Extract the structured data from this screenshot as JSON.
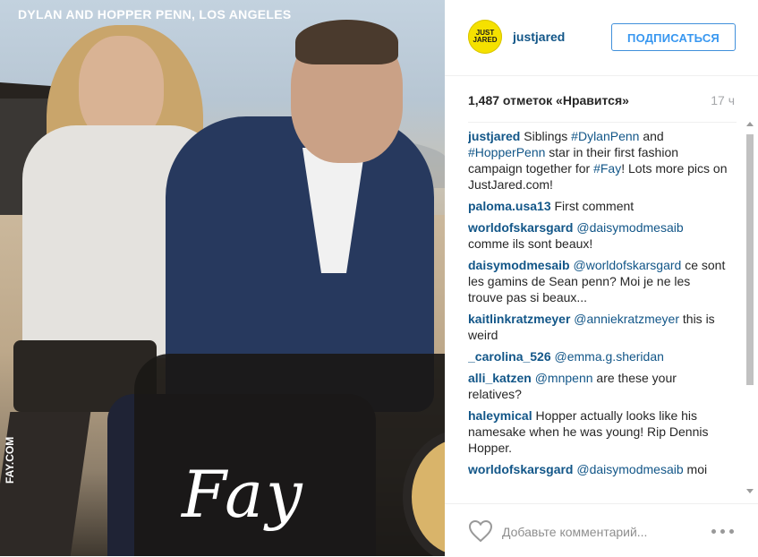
{
  "photo": {
    "caption": "DYLAN AND HOPPER PENN, LOS ANGELES",
    "brand": "Fay",
    "url_text": "FAY.COM"
  },
  "header": {
    "avatar_text": "JUST JARED",
    "username": "justjared",
    "follow_label": "ПОДПИСАТЬСЯ"
  },
  "stats": {
    "likes": "1,487 отметок «Нравится»",
    "time": "17 ч"
  },
  "comments": [
    {
      "user": "justjared",
      "parts": [
        {
          "t": "text",
          "v": " Siblings "
        },
        {
          "t": "tag",
          "v": "#DylanPenn"
        },
        {
          "t": "text",
          "v": " and "
        },
        {
          "t": "tag",
          "v": "#HopperPenn"
        },
        {
          "t": "text",
          "v": " star in their first fashion campaign together for "
        },
        {
          "t": "tag",
          "v": "#Fay"
        },
        {
          "t": "text",
          "v": "! Lots more pics on JustJared.com!"
        }
      ]
    },
    {
      "user": "paloma.usa13",
      "parts": [
        {
          "t": "text",
          "v": " First comment"
        }
      ]
    },
    {
      "user": "worldofskarsgard",
      "parts": [
        {
          "t": "text",
          "v": " "
        },
        {
          "t": "mention",
          "v": "@daisymodmesaib"
        },
        {
          "t": "text",
          "v": " comme ils sont beaux!"
        }
      ]
    },
    {
      "user": "daisymodmesaib",
      "parts": [
        {
          "t": "text",
          "v": " "
        },
        {
          "t": "mention",
          "v": "@worldofskarsgard"
        },
        {
          "t": "text",
          "v": " ce sont les gamins de Sean penn? Moi je ne les trouve pas si beaux..."
        }
      ]
    },
    {
      "user": "kaitlinkratzmeyer",
      "parts": [
        {
          "t": "text",
          "v": " "
        },
        {
          "t": "mention",
          "v": "@anniekratzmeyer"
        },
        {
          "t": "text",
          "v": " this is weird"
        }
      ]
    },
    {
      "user": "_carolina_526",
      "parts": [
        {
          "t": "text",
          "v": " "
        },
        {
          "t": "mention",
          "v": "@emma.g.sheridan"
        }
      ]
    },
    {
      "user": "alli_katzen",
      "parts": [
        {
          "t": "text",
          "v": " "
        },
        {
          "t": "mention",
          "v": "@mnpenn"
        },
        {
          "t": "text",
          "v": " are these your relatives?"
        }
      ]
    },
    {
      "user": "haleymical",
      "parts": [
        {
          "t": "text",
          "v": " Hopper actually looks like his namesake when he was young! Rip Dennis Hopper."
        }
      ]
    },
    {
      "user": "worldofskarsgard",
      "parts": [
        {
          "t": "text",
          "v": " "
        },
        {
          "t": "mention",
          "v": "@daisymodmesaib"
        },
        {
          "t": "text",
          "v": " moi"
        }
      ]
    }
  ],
  "footer": {
    "heart_icon": "heart-icon",
    "comment_placeholder": "Добавьте комментарий...",
    "more_icon": "more-options-icon"
  },
  "colors": {
    "link": "#125688",
    "follow": "#3897f0",
    "avatar": "#f5e100"
  }
}
